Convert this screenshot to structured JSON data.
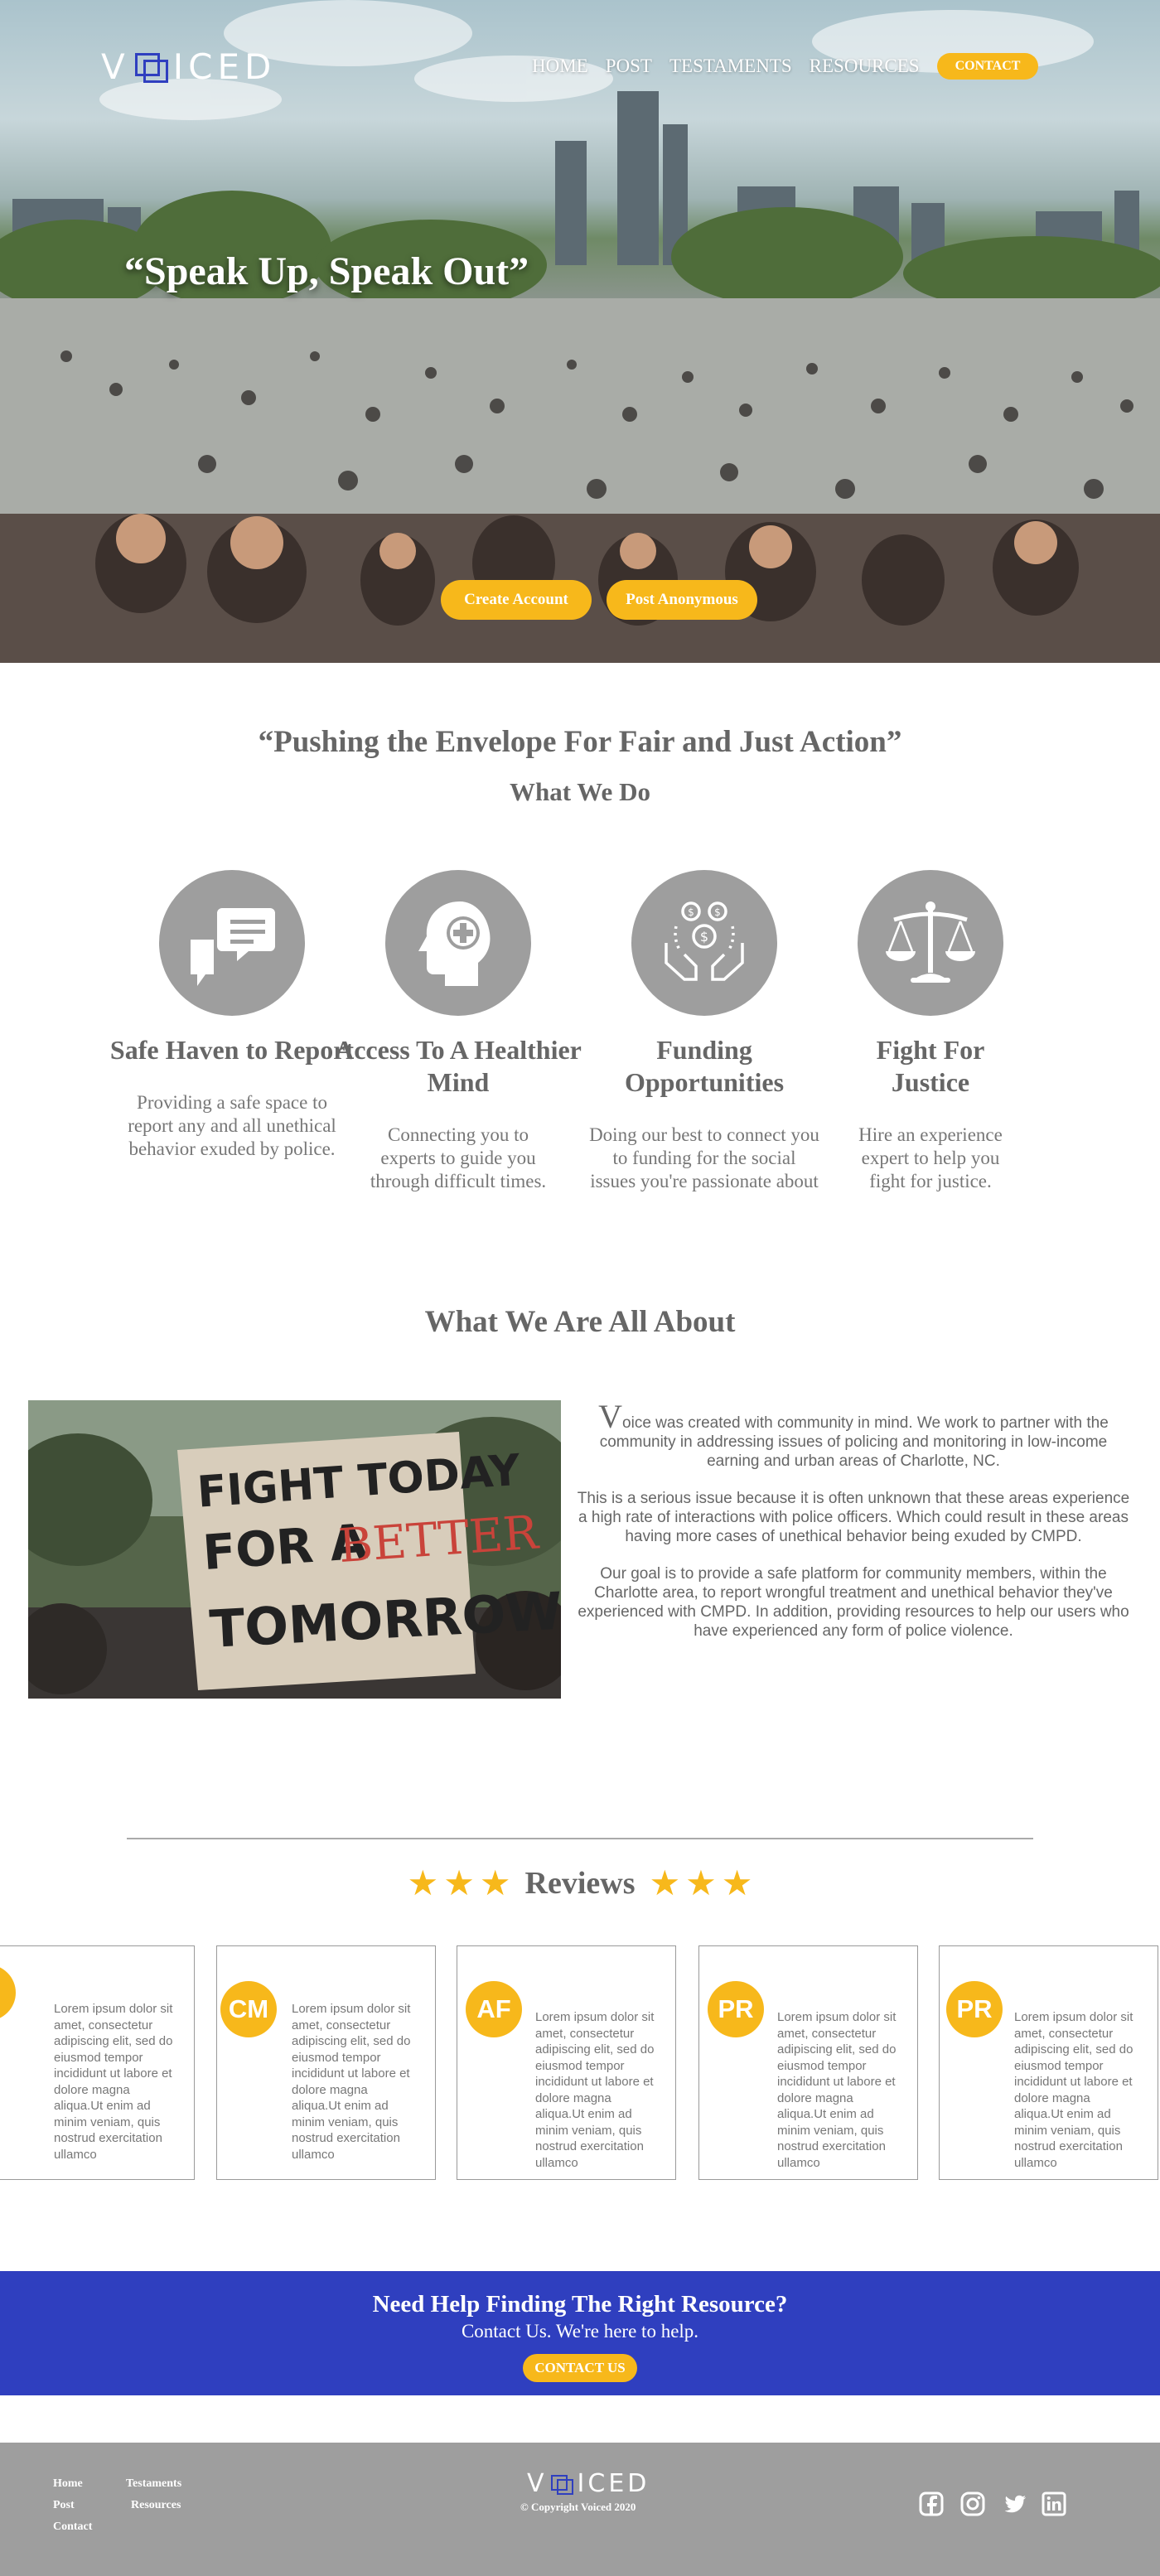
{
  "brand": {
    "logo_text_left": "V",
    "logo_text_right": "ICED",
    "accent": "#f7b81b",
    "blue": "#2f3fbf",
    "gray": "#9e9e9e"
  },
  "nav": {
    "items": [
      "HOME",
      "POST",
      "TESTAMENTS",
      "RESOURCES"
    ],
    "contact_label": "CONTACT"
  },
  "hero": {
    "title": "“Speak Up, Speak Out”",
    "create_account_label": "Create Account",
    "post_anonymous_label": "Post Anonymous"
  },
  "mission": {
    "tagline": "“Pushing the Envelope For Fair and Just Action”",
    "heading": "What We Do",
    "features": [
      {
        "icon": "chat-bubbles-icon",
        "title": "Safe Haven to Report",
        "desc": "Providing a safe space to report any  and all unethical behavior exuded by police."
      },
      {
        "icon": "head-plus-icon",
        "title": "Access To A Healthier Mind",
        "desc": "Connecting you to experts to guide you through difficult times."
      },
      {
        "icon": "hands-money-icon",
        "title": "Funding Opportunities",
        "desc": "Doing our best to connect you to funding for the social issues you're passionate about"
      },
      {
        "icon": "justice-scale-icon",
        "title": "Fight For Justice",
        "desc": "Hire an experience expert to help you fight for justice."
      }
    ]
  },
  "about": {
    "heading": "What We Are All About",
    "sign_lines": [
      "FIGHT TODAY",
      "FOR A",
      "BETTER",
      "TOMORROW"
    ],
    "dropcap": "V",
    "p1_rest": "oice was created with community in mind. We work to partner with the community in addressing issues of policing and monitoring in low-income earning and urban areas of Charlotte, NC.",
    "p2": "This is a serious issue because it is often unknown that these areas experience a high rate of interactions with police officers. Which could result in these areas having more cases of unethical behavior being exuded by CMPD.",
    "p3": "Our goal is to provide a safe platform for community members, within the Charlotte area, to report wrongful treatment and unethical behavior they've experienced with CMPD. In addition, providing resources to help our users who have experienced any form of police violence."
  },
  "reviews": {
    "heading": "Reviews",
    "stars": "★",
    "cards": [
      {
        "initials": "M",
        "text": "Lorem ipsum dolor sit amet, consectetur adipiscing elit, sed do eiusmod tempor incididunt ut labore et dolore magna aliqua.Ut enim ad minim veniam, quis nostrud exercitation ullamco"
      },
      {
        "initials": "CM",
        "text": "Lorem ipsum dolor sit amet, consectetur adipiscing elit, sed do eiusmod tempor incididunt ut labore et dolore magna aliqua.Ut enim ad minim veniam, quis nostrud exercitation ullamco"
      },
      {
        "initials": "AF",
        "text": "Lorem ipsum dolor sit amet, consectetur adipiscing elit, sed do eiusmod tempor incididunt ut labore et dolore magna aliqua.Ut enim ad minim veniam, quis nostrud exercitation ullamco"
      },
      {
        "initials": "PR",
        "text": "Lorem ipsum dolor sit amet, consectetur adipiscing elit, sed do eiusmod tempor incididunt ut labore et dolore magna aliqua.Ut enim ad minim veniam, quis nostrud exercitation ullamco"
      },
      {
        "initials": "PR",
        "text": "Lorem ipsum dolor sit amet, consectetur adipiscing elit, sed do eiusmod tempor incididunt ut labore et dolore magna aliqua.Ut enim ad minim veniam, quis nostrud exercitation ullamco"
      }
    ]
  },
  "cta": {
    "title": "Need Help Finding The Right Resource?",
    "subtitle": "Contact Us. We're here to help.",
    "button_label": "CONTACT US"
  },
  "footer": {
    "links": [
      "Home",
      "Testaments",
      "Post",
      "Resources",
      "Contact"
    ],
    "copyright": "Copyright Voiced 2020",
    "copyright_symbol": "©",
    "social": [
      "facebook-icon",
      "instagram-icon",
      "twitter-icon",
      "linkedin-icon"
    ]
  }
}
